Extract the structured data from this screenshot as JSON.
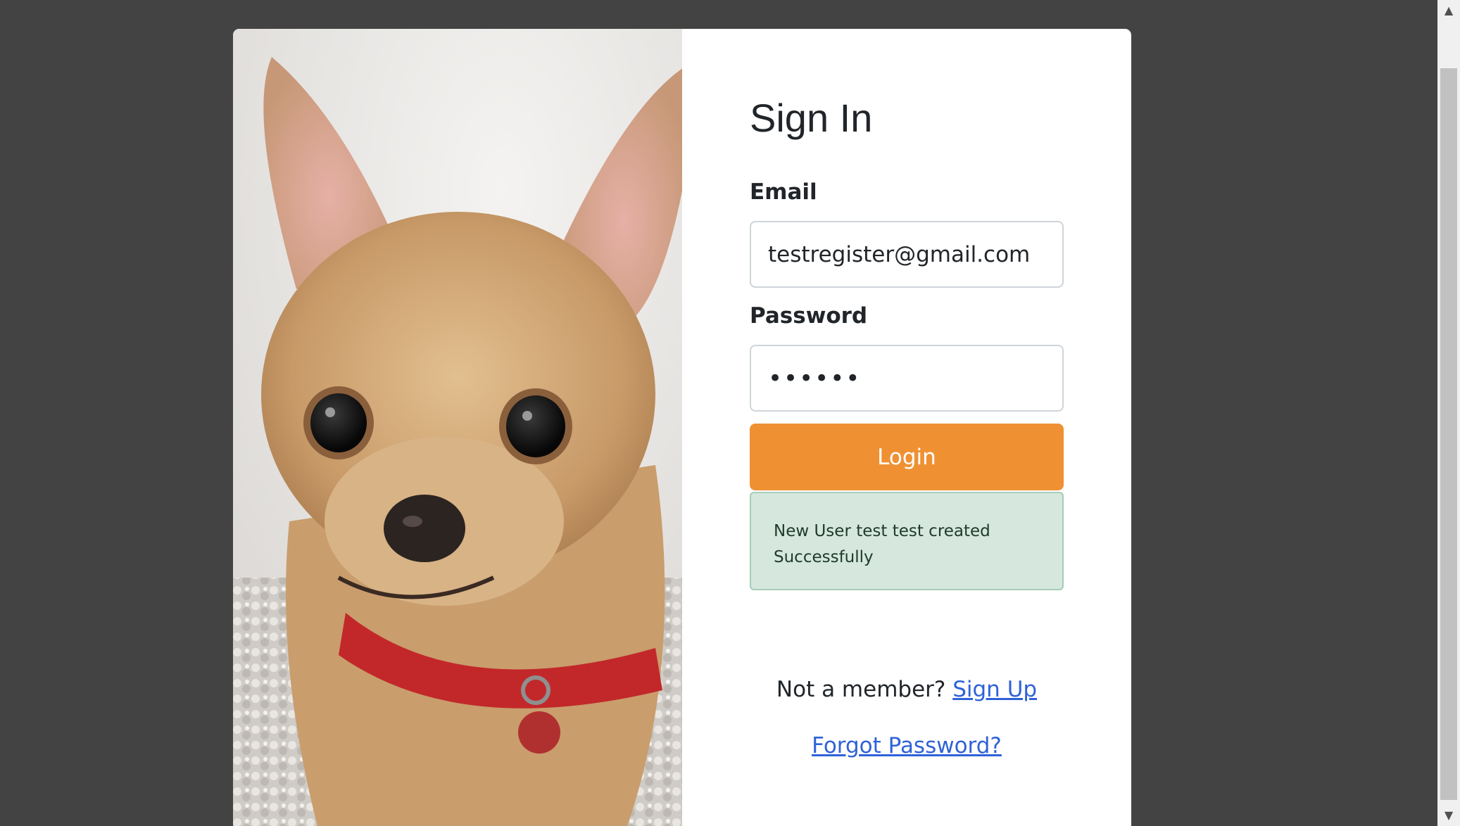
{
  "page": {
    "title": "Sign In"
  },
  "form": {
    "email_label": "Email",
    "email_value": "testregister@gmail.com",
    "password_label": "Password",
    "password_value": "••••••",
    "login_label": "Login"
  },
  "alert": {
    "message": "New User test test created Successfully"
  },
  "footer": {
    "member_text": "Not a member? ",
    "signup_label": "Sign Up",
    "forgot_label": "Forgot Password?"
  },
  "image": {
    "subject": "chihuahua puppy with red collar"
  },
  "colors": {
    "background": "#434343",
    "accent": "#ef9133",
    "alert_bg": "#d6e7de",
    "link": "#2f62d8"
  },
  "icons": {
    "scroll_up": "scroll-up-arrow-icon",
    "scroll_down": "scroll-down-arrow-icon"
  }
}
